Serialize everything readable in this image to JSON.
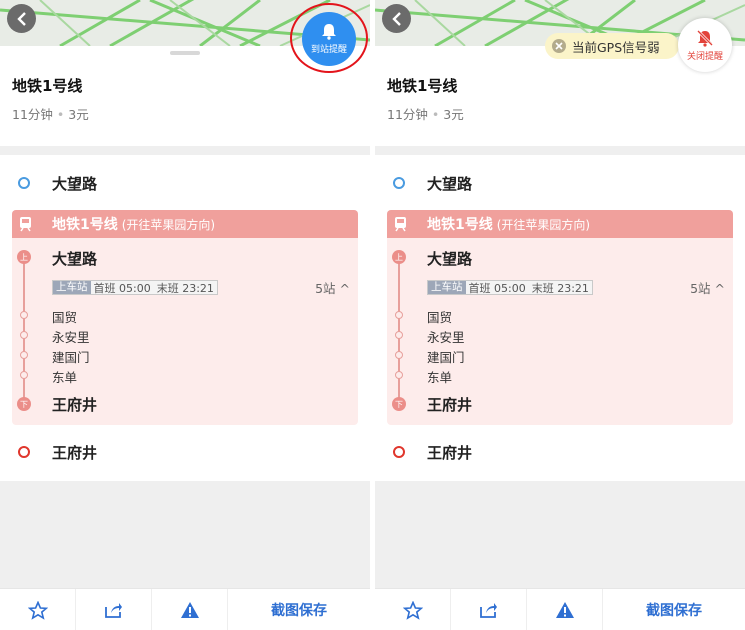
{
  "colors": {
    "accent_blue": "#2f8ff0",
    "line_red": "#f0a09c",
    "circle_red": "#e3141b",
    "text_blue": "#2f6fd2"
  },
  "route": {
    "title": "地铁1号线",
    "duration": "11分钟",
    "price": "3元"
  },
  "origin": "大望路",
  "destination": "王府井",
  "line": {
    "name": "地铁1号线",
    "direction": "(开往苹果园方向)",
    "board_badge": "上",
    "alight_badge": "下",
    "board_stop": "大望路",
    "board_tag": "上车站",
    "first_train": "首班 05:00",
    "last_train": "末班 23:21",
    "stop_count": "5站 ^",
    "intermediate": [
      "国贸",
      "永安里",
      "建国门",
      "东单"
    ],
    "alight_stop": "王府井"
  },
  "left_panel": {
    "alert_label": "到站提醒",
    "alert_icon": "bell-icon"
  },
  "right_panel": {
    "alert_label": "关闭提醒",
    "alert_icon": "bell-off-icon",
    "gps_toast": "当前GPS信号弱"
  },
  "toolbar": {
    "icons": [
      "star-icon",
      "share-icon",
      "warning-icon"
    ],
    "save_label": "截图保存"
  }
}
